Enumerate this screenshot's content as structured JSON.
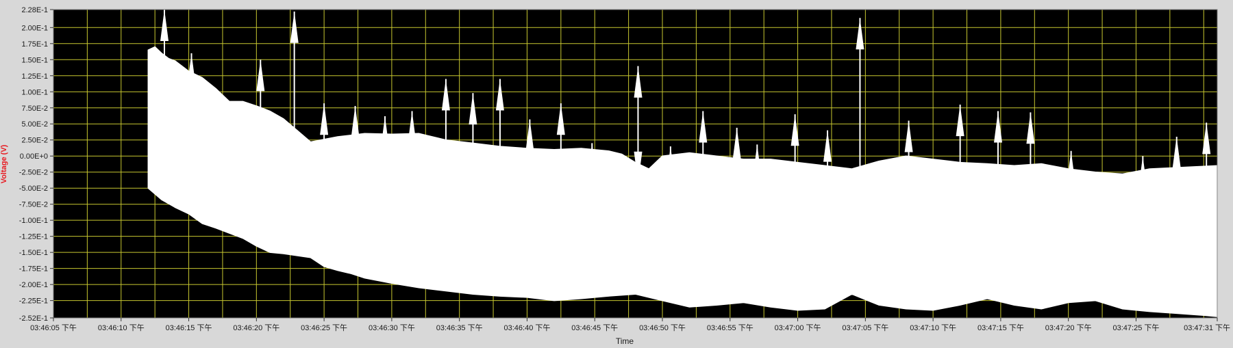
{
  "chart_data": {
    "type": "area",
    "title": "",
    "xlabel": "Time",
    "ylabel": "Voltage (V)",
    "ylim": [
      -0.252,
      0.228
    ],
    "xlim_seconds_of_day": [
      13565,
      13651
    ],
    "grid": true,
    "colors": {
      "plot_bg": "#000000",
      "trace": "#ffffff",
      "grid": "#c8c830",
      "ylabel": "#e8181f",
      "frame_bg": "#d8d8d8"
    },
    "y_ticks": [
      "2.28E-1",
      "2.00E-1",
      "1.75E-1",
      "1.50E-1",
      "1.25E-1",
      "1.00E-1",
      "7.50E-2",
      "5.00E-2",
      "2.50E-2",
      "0.00E+0",
      "-2.50E-2",
      "-5.00E-2",
      "-7.50E-2",
      "-1.00E-1",
      "-1.25E-1",
      "-1.50E-1",
      "-1.75E-1",
      "-2.00E-1",
      "-2.25E-1",
      "-2.52E-1"
    ],
    "x_ticks": [
      "03:46:05 下午",
      "03:46:10 下午",
      "03:46:15 下午",
      "03:46:20 下午",
      "03:46:25 下午",
      "03:46:30 下午",
      "03:46:35 下午",
      "03:46:40 下午",
      "03:46:45 下午",
      "03:46:50 下午",
      "03:46:55 下午",
      "03:47:00 下午",
      "03:47:05 下午",
      "03:47:10 下午",
      "03:47:15 下午",
      "03:47:20 下午",
      "03:47:25 下午",
      "03:47:31 下午"
    ],
    "series": [
      {
        "upper": [
          [
            "03:46:12",
            0.165
          ],
          [
            "03:46:12.5",
            0.17
          ],
          [
            "03:46:13",
            0.16
          ],
          [
            "03:46:13.5",
            0.152
          ],
          [
            "03:46:14",
            0.148
          ],
          [
            "03:46:15",
            0.132
          ],
          [
            "03:46:16",
            0.122
          ],
          [
            "03:46:17",
            0.105
          ],
          [
            "03:46:18",
            0.085
          ],
          [
            "03:46:19",
            0.085
          ],
          [
            "03:46:20",
            0.078
          ],
          [
            "03:46:21",
            0.07
          ],
          [
            "03:46:22",
            0.058
          ],
          [
            "03:46:23",
            0.04
          ],
          [
            "03:46:24",
            0.022
          ],
          [
            "03:46:26",
            0.03
          ],
          [
            "03:46:28",
            0.035
          ],
          [
            "03:46:30",
            0.034
          ],
          [
            "03:46:32",
            0.035
          ],
          [
            "03:46:34",
            0.025
          ],
          [
            "03:46:36",
            0.02
          ],
          [
            "03:46:38",
            0.015
          ],
          [
            "03:46:40",
            0.012
          ],
          [
            "03:46:42",
            0.01
          ],
          [
            "03:46:44",
            0.012
          ],
          [
            "03:46:46",
            0.008
          ],
          [
            "03:46:47",
            0.003
          ],
          [
            "03:46:48",
            -0.01
          ],
          [
            "03:46:49",
            -0.02
          ],
          [
            "03:46:50",
            0.0
          ],
          [
            "03:46:52",
            0.005
          ],
          [
            "03:46:54",
            0.0
          ],
          [
            "03:46:56",
            -0.005
          ],
          [
            "03:46:58",
            -0.005
          ],
          [
            "03:47:00",
            -0.01
          ],
          [
            "03:47:02",
            -0.015
          ],
          [
            "03:47:04",
            -0.02
          ],
          [
            "03:47:06",
            -0.008
          ],
          [
            "03:47:08",
            0.0
          ],
          [
            "03:47:10",
            -0.005
          ],
          [
            "03:47:12",
            -0.01
          ],
          [
            "03:47:14",
            -0.012
          ],
          [
            "03:47:16",
            -0.015
          ],
          [
            "03:47:18",
            -0.012
          ],
          [
            "03:47:20",
            -0.02
          ],
          [
            "03:47:22",
            -0.025
          ],
          [
            "03:47:24",
            -0.028
          ],
          [
            "03:47:26",
            -0.02
          ],
          [
            "03:47:28",
            -0.018
          ],
          [
            "03:47:31",
            -0.015
          ]
        ],
        "lower": [
          [
            "03:46:12",
            -0.05
          ],
          [
            "03:46:13",
            -0.068
          ],
          [
            "03:46:14",
            -0.08
          ],
          [
            "03:46:15",
            -0.09
          ],
          [
            "03:46:16",
            -0.105
          ],
          [
            "03:46:17",
            -0.112
          ],
          [
            "03:46:18",
            -0.12
          ],
          [
            "03:46:19",
            -0.128
          ],
          [
            "03:46:20",
            -0.14
          ],
          [
            "03:46:21",
            -0.15
          ],
          [
            "03:46:22",
            -0.152
          ],
          [
            "03:46:23",
            -0.155
          ],
          [
            "03:46:24",
            -0.158
          ],
          [
            "03:46:25",
            -0.172
          ],
          [
            "03:46:26",
            -0.178
          ],
          [
            "03:46:27",
            -0.183
          ],
          [
            "03:46:28",
            -0.19
          ],
          [
            "03:46:30",
            -0.198
          ],
          [
            "03:46:32",
            -0.205
          ],
          [
            "03:46:34",
            -0.21
          ],
          [
            "03:46:36",
            -0.215
          ],
          [
            "03:46:38",
            -0.218
          ],
          [
            "03:46:40",
            -0.22
          ],
          [
            "03:46:42",
            -0.225
          ],
          [
            "03:46:44",
            -0.222
          ],
          [
            "03:46:46",
            -0.218
          ],
          [
            "03:46:48",
            -0.215
          ],
          [
            "03:46:50",
            -0.225
          ],
          [
            "03:46:52",
            -0.235
          ],
          [
            "03:46:54",
            -0.232
          ],
          [
            "03:46:56",
            -0.228
          ],
          [
            "03:46:58",
            -0.235
          ],
          [
            "03:47:00",
            -0.24
          ],
          [
            "03:47:02",
            -0.238
          ],
          [
            "03:47:04",
            -0.215
          ],
          [
            "03:47:06",
            -0.232
          ],
          [
            "03:47:08",
            -0.238
          ],
          [
            "03:47:10",
            -0.24
          ],
          [
            "03:47:12",
            -0.232
          ],
          [
            "03:47:14",
            -0.222
          ],
          [
            "03:47:16",
            -0.232
          ],
          [
            "03:47:18",
            -0.238
          ],
          [
            "03:47:20",
            -0.228
          ],
          [
            "03:47:22",
            -0.225
          ],
          [
            "03:47:24",
            -0.238
          ],
          [
            "03:47:26",
            -0.242
          ],
          [
            "03:47:28",
            -0.245
          ],
          [
            "03:47:30",
            -0.248
          ],
          [
            "03:47:31",
            -0.25
          ]
        ],
        "spikes": [
          [
            "03:46:13.2",
            0.228,
            -0.04
          ],
          [
            "03:46:15.2",
            0.16,
            -0.075
          ],
          [
            "03:46:20.3",
            0.15,
            -0.07
          ],
          [
            "03:46:22.8",
            0.225,
            -0.148
          ],
          [
            "03:46:25",
            0.082,
            -0.1
          ],
          [
            "03:46:27.3",
            0.078,
            -0.148
          ],
          [
            "03:46:29.5",
            0.062,
            -0.17
          ],
          [
            "03:46:31.5",
            0.07,
            -0.17
          ],
          [
            "03:46:34",
            0.12,
            -0.1
          ],
          [
            "03:46:36",
            0.098,
            -0.13
          ],
          [
            "03:46:38",
            0.12,
            -0.105
          ],
          [
            "03:46:40.2",
            0.057,
            -0.17
          ],
          [
            "03:46:42.5",
            0.082,
            -0.148
          ],
          [
            "03:46:44.8",
            0.02,
            -0.205
          ],
          [
            "03:46:48.2",
            0.14,
            -0.042
          ],
          [
            "03:46:50.6",
            0.015,
            -0.19
          ],
          [
            "03:46:53",
            0.07,
            -0.168
          ],
          [
            "03:46:55.5",
            0.044,
            -0.158
          ],
          [
            "03:46:57",
            0.018,
            -0.2
          ],
          [
            "03:46:59.8",
            0.065,
            -0.17
          ],
          [
            "03:47:02.2",
            0.04,
            -0.18
          ],
          [
            "03:47:04.6",
            0.215,
            -0.095
          ],
          [
            "03:47:08.2",
            0.055,
            -0.18
          ],
          [
            "03:47:12",
            0.08,
            -0.138
          ],
          [
            "03:47:14.8",
            0.07,
            -0.168
          ],
          [
            "03:47:17.2",
            0.068,
            -0.158
          ],
          [
            "03:47:20.2",
            0.008,
            -0.2
          ],
          [
            "03:47:25.5",
            0.0,
            -0.205
          ],
          [
            "03:47:28",
            0.03,
            -0.185
          ],
          [
            "03:47:30.2",
            0.052,
            -0.168
          ]
        ]
      }
    ]
  }
}
